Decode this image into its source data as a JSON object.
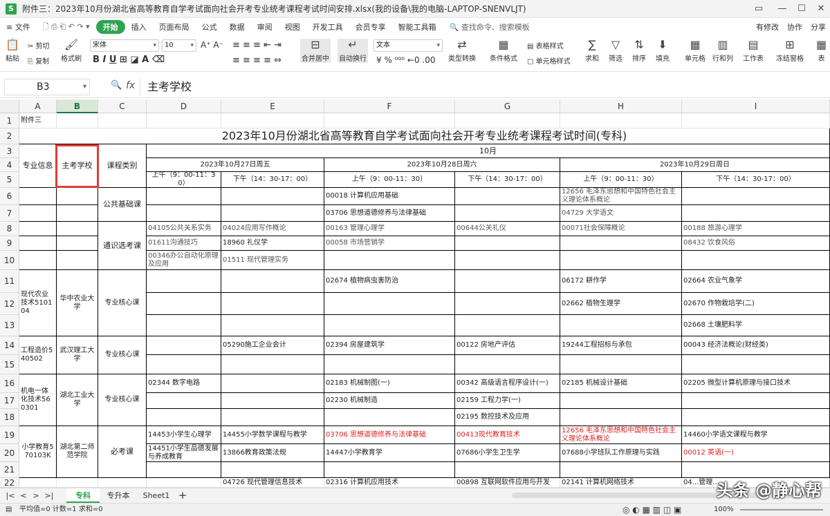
{
  "titlebar": {
    "app_icon": "S",
    "title": "附件三：2023年10月份湖北省高等教育自学考试面向社会开考专业统考课程考试时间安排.xlsx(我的设备\\我的电脑-LAPTOP-SNENVLJT)",
    "controls": {
      "view_icon": "layout-icon",
      "minimize": "—",
      "maximize": "☐",
      "close": "✕"
    }
  },
  "menu": {
    "items": [
      "≡ 文件",
      "开始",
      "插入",
      "页面布局",
      "公式",
      "数据",
      "审阅",
      "视图",
      "开发工具",
      "会员专享",
      "智能工具箱"
    ],
    "active": "开始",
    "search_placeholder": "查找命令、搜索模板",
    "right": [
      "有修改",
      "协作",
      "分享"
    ]
  },
  "ribbon": {
    "paste": "粘贴",
    "cut": "剪切",
    "copy": "复制",
    "format_painter": "格式刷",
    "font": "宋体",
    "font_size": "10",
    "merge": "合并居中",
    "wrap": "自动换行",
    "num_format": "文本",
    "type_convert": "类型转换",
    "cond_format": "条件格式",
    "table_style": "表格样式",
    "cell_style": "单元格样式",
    "sum": "求和",
    "filter": "筛选",
    "sort": "排序",
    "fill": "填充",
    "cells": "单元格",
    "rowcol": "行和列",
    "sheet": "工作表",
    "freeze": "冻结窗格",
    "t_right": "表"
  },
  "formula_bar": {
    "name_box": "B3",
    "fx": "fx",
    "content": "主考学校"
  },
  "columns": [
    "A",
    "B",
    "C",
    "D",
    "E",
    "F",
    "G",
    "H",
    "I"
  ],
  "selected_col": "B",
  "rows": [
    "1",
    "2",
    "3",
    "4",
    "5",
    "6",
    "7",
    "8",
    "9",
    "10",
    "11",
    "12",
    "13",
    "14",
    "15",
    "16",
    "17",
    "18",
    "19",
    "20",
    "21",
    "22"
  ],
  "cells": {
    "a1": "附件三",
    "title": "2023年10月份湖北省高等教育自学考试面向社会开考专业统考课程考试时间(专科)",
    "month": "10月",
    "hdr_major": "专业信息",
    "hdr_school": "主考学校",
    "hdr_type": "课程类别",
    "d27": "2023年10月27日周五",
    "d28": "2023年10月28日周六",
    "d29": "2023年10月29日周日",
    "am": "上午（9：00-11：30）",
    "pm": "下午（14：30-17：00）",
    "am_wrap": "上午（9：00-11：30）",
    "pub": "公共基础课",
    "gen": "通识选考课",
    "core": "专业核心课",
    "req": "必考课",
    "f6": "00018 计算机应用基础",
    "h6": "12656 毛泽东思想和中国特色社会主义理论体系概论",
    "f7": "03706 思想道德修养与法律基础",
    "h7": "04729 大学语文",
    "d8": "04105公共关系实务",
    "e8": "04024应用写作概论",
    "f8": "00163 管理心理学",
    "g8": "00644公关礼仪",
    "h8": "00071社会保障概论",
    "i8": "00188 旅游心理学",
    "d9": "01611沟通技巧",
    "e9": "18960 礼仪学",
    "f9": "00058 市场营销学",
    "i9": "08432 饮食风俗",
    "d10": "00346办公自动化原理及应用",
    "e10": "01511 现代管理实务",
    "a11": "现代农业技术510104",
    "b11": "华中农业大学",
    "f11": "02674 植物病虫害防治",
    "h11": "06172 耕作学",
    "i11": "02664 农业气象学",
    "h12": "02662 植物生理学",
    "i12": "02670 作物栽培学(二)",
    "i13": "02668 土壤肥料学",
    "a14": "工程造价540502",
    "b14": "武汉理工大学",
    "e14": "05290施工企业会计",
    "f14": "02394 房屋建筑学",
    "g14": "00122 房地产评估",
    "h14": "19244工程招标与承包",
    "i14": "00043 经济法概论(财经类)",
    "a16": "机电一体化技术560301",
    "b16": "湖北工业大学",
    "d16": "02344 数字电路",
    "f16": "02183 机械制图(一)",
    "g16": "00342 高级语言程序设计(一)",
    "h16": "02185 机械设计基础",
    "i16": "02205 微型计算机原理与接口技术",
    "f17": "02230 机械制造",
    "g17": "02159 工程力学(一)",
    "g18": "02195 数控技术及应用",
    "a19": "小学教育570103K",
    "b19": "湖北第二师范学院",
    "d19": "14453小学生心理学",
    "e19": "14455小学数学课程与教学",
    "f19": "03706 思想道德修养与法律基础",
    "g19": "00413现代教育技术",
    "h19": "12656 毛泽东思想和中国特色社会主义理论体系概论",
    "i19": "14460小学语文课程与教学",
    "d20": "14451小学生品德发展与养成教育",
    "e20": "13866教育政策法规",
    "f20": "14447小学教育学",
    "g20": "07686小学生卫生学",
    "h20": "07688小学班队工作原理与实践",
    "i20": "00012 英语(一)",
    "e22": "04726 现代管理信息技术",
    "f22": "02316 计算机应用技术",
    "g22": "00898 互联网软件应用与开发",
    "h22": "02141 计算机网络技术",
    "i22": "04...管理..."
  },
  "tabs": {
    "nav": [
      "|<",
      "<",
      ">",
      ">|"
    ],
    "sheets": [
      "专科",
      "专升本",
      "Sheet1"
    ],
    "active": "专科",
    "add": "+"
  },
  "status": {
    "left": "平均值=0  计数=1  求和=0",
    "zoom": "100%"
  },
  "watermark": "头条 @静心帮"
}
